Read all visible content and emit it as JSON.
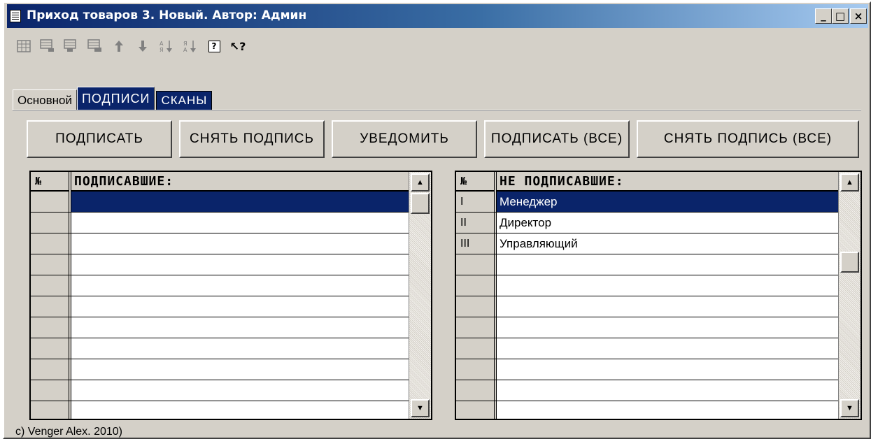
{
  "window": {
    "title": "Приход товаров 3. Новый. Автор: Админ",
    "controls": {
      "minimize": "_",
      "maximize": "□",
      "close": "×"
    }
  },
  "toolbar": {
    "icons": [
      "table-icon",
      "add-row-icon",
      "insert-row-icon",
      "delete-row-icon",
      "move-up-icon",
      "move-down-icon",
      "sort-ascending-icon",
      "sort-descending-icon",
      "help-icon",
      "context-help-icon"
    ],
    "help_glyph": "?",
    "context_help_glyph": "↖?"
  },
  "tabs": {
    "main": "Основной",
    "signatures": "ПОДПИСИ",
    "scans": "СКАНЫ"
  },
  "buttons": {
    "sign": "ПОДПИСАТЬ",
    "remove_signature": "СНЯТЬ ПОДПИСЬ",
    "notify": "УВЕДОМИТЬ",
    "sign_all": "ПОДПИСАТЬ (ВСЕ)",
    "remove_signature_all": "СНЯТЬ ПОДПИСЬ (ВСЕ)"
  },
  "signed_grid": {
    "num_header": "№",
    "title": "ПОДПИСАВШИЕ:",
    "rows": [
      "",
      "",
      "",
      "",
      "",
      "",
      "",
      "",
      "",
      "",
      ""
    ]
  },
  "unsigned_grid": {
    "num_header": "№",
    "title": "НЕ ПОДПИСАВШИЕ:",
    "rows": [
      {
        "num": "I",
        "name": "Менеджер"
      },
      {
        "num": "II",
        "name": "Директор"
      },
      {
        "num": "III",
        "name": "Управляющий"
      },
      {
        "num": "",
        "name": ""
      },
      {
        "num": "",
        "name": ""
      },
      {
        "num": "",
        "name": ""
      },
      {
        "num": "",
        "name": ""
      },
      {
        "num": "",
        "name": ""
      },
      {
        "num": "",
        "name": ""
      },
      {
        "num": "",
        "name": ""
      },
      {
        "num": "",
        "name": ""
      }
    ]
  },
  "scroll_arrows": {
    "up": "▲",
    "down": "▼"
  },
  "status": "c) Venger Alex. 2010)",
  "colors": {
    "face": "#d4d0c8",
    "selection": "#0a246a",
    "title_gradient_start": "#0a246a",
    "title_gradient_end": "#a6caf0"
  }
}
